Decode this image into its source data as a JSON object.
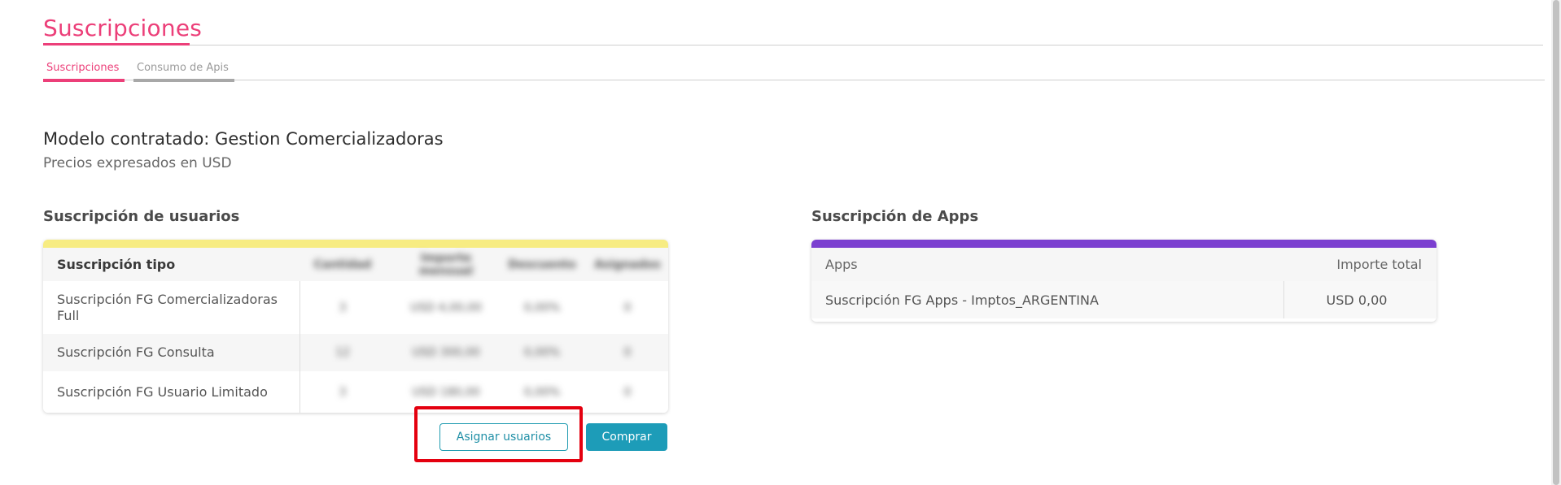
{
  "page": {
    "title": "Suscripciones"
  },
  "tabs": [
    {
      "label": "Suscripciones",
      "active": true
    },
    {
      "label": "Consumo de Apis",
      "active": false
    }
  ],
  "model": {
    "title": "Modelo contratado: Gestion Comercializadoras",
    "subtitle": "Precios expresados en USD"
  },
  "users_section": {
    "title": "Suscripción de usuarios",
    "columns": [
      "Suscripción tipo",
      "Cantidad",
      "Importe mensual",
      "Descuento",
      "Asignados"
    ],
    "rows": [
      {
        "type": "Suscripción FG Comercializadoras Full",
        "cantidad": "3",
        "importe": "USD 4,00,00",
        "descuento": "0,00%",
        "asignados": "0"
      },
      {
        "type": "Suscripción FG Consulta",
        "cantidad": "12",
        "importe": "USD 300,00",
        "descuento": "0,00%",
        "asignados": "0"
      },
      {
        "type": "Suscripción FG Usuario Limitado",
        "cantidad": "3",
        "importe": "USD 180,00",
        "descuento": "0,00%",
        "asignados": "0"
      }
    ],
    "assign_button": "Asignar usuarios",
    "buy_button": "Comprar",
    "accent_color": "#f7ec82"
  },
  "apps_section": {
    "title": "Suscripción de Apps",
    "columns": [
      "Apps",
      "Importe total"
    ],
    "rows": [
      {
        "app": "Suscripción FG Apps - Imptos_ARGENTINA",
        "total": "USD 0,00"
      }
    ],
    "accent_color": "#7b3fd0"
  },
  "colors": {
    "brand": "#ec3f79",
    "action": "#1d9cb8",
    "highlight": "#e4000f"
  }
}
